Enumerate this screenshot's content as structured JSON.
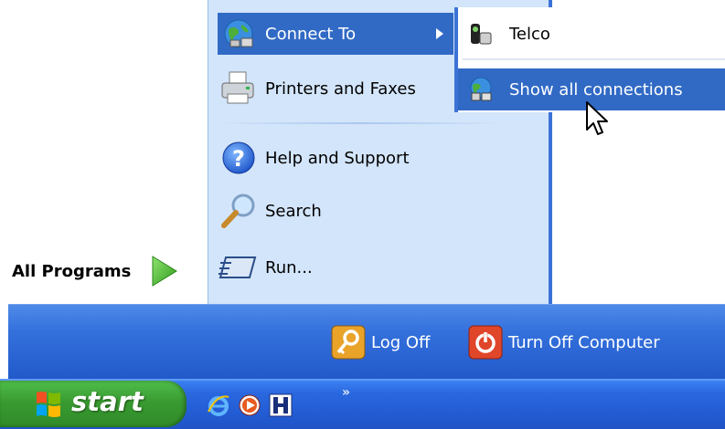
{
  "start_menu": {
    "all_programs_label": "All Programs",
    "items": {
      "connect_to": "Connect To",
      "printers": "Printers and Faxes",
      "help": "Help and Support",
      "search": "Search",
      "run": "Run..."
    },
    "submenu": {
      "telco": "Telco",
      "show_all": "Show all connections"
    },
    "footer": {
      "log_off": "Log Off",
      "turn_off": "Turn Off Computer"
    }
  },
  "taskbar": {
    "start_label": "start",
    "overflow": "»"
  },
  "colors": {
    "highlight": "#316ac5",
    "right_pane": "#d3e5fa",
    "bottom_bar": "#3471dc",
    "start_green": "#3a9b32"
  }
}
